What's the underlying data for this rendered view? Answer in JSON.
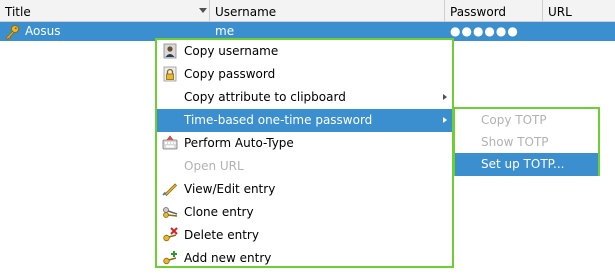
{
  "table": {
    "columns": [
      "Title",
      "Username",
      "Password",
      "URL"
    ],
    "row": {
      "title": "Aosus",
      "username": "me",
      "password": "●●●●●●",
      "url": ""
    }
  },
  "context_menu": {
    "items": [
      {
        "label": "Copy username",
        "icon": "user-icon",
        "enabled": true
      },
      {
        "label": "Copy password",
        "icon": "lock-icon",
        "enabled": true
      },
      {
        "label": "Copy attribute to clipboard",
        "icon": "",
        "enabled": true,
        "submenu": true
      },
      {
        "label": "Time-based one-time password",
        "icon": "",
        "enabled": true,
        "submenu": true,
        "highlighted": true
      },
      {
        "label": "Perform Auto-Type",
        "icon": "keyboard-icon",
        "enabled": true
      },
      {
        "label": "Open URL",
        "icon": "",
        "enabled": false
      },
      {
        "label": "View/Edit entry",
        "icon": "edit-icon",
        "enabled": true
      },
      {
        "label": "Clone entry",
        "icon": "clone-icon",
        "enabled": true
      },
      {
        "label": "Delete entry",
        "icon": "delete-icon",
        "enabled": true
      },
      {
        "label": "Add new entry",
        "icon": "add-icon",
        "enabled": true
      }
    ]
  },
  "submenu": {
    "items": [
      {
        "label": "Copy TOTP",
        "enabled": false
      },
      {
        "label": "Show TOTP",
        "enabled": false
      },
      {
        "label": "Set up TOTP...",
        "enabled": true,
        "highlighted": true
      }
    ]
  },
  "colors": {
    "selection": "#3c8fcf",
    "menu_outline": "#6dcf32",
    "disabled_text": "#b2b2b2"
  }
}
